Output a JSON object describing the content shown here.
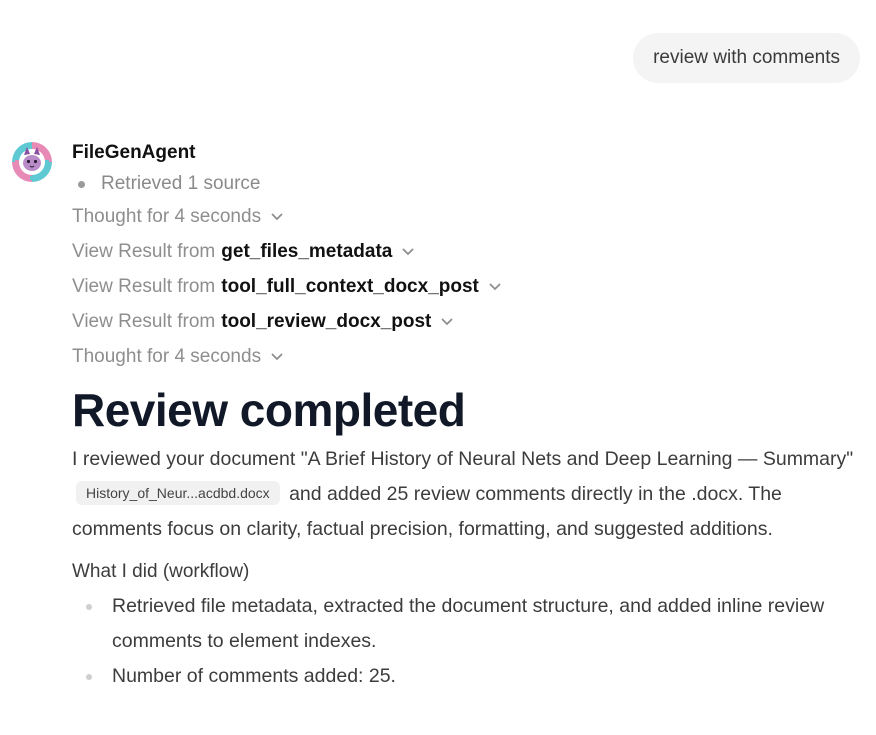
{
  "user_message": "review with comments",
  "agent": {
    "name": "FileGenAgent",
    "sources": "Retrieved 1 source"
  },
  "steps": [
    {
      "prefix": "Thought for 4 seconds",
      "tool": ""
    },
    {
      "prefix": "View Result from",
      "tool": "get_files_metadata"
    },
    {
      "prefix": "View Result from",
      "tool": "tool_full_context_docx_post"
    },
    {
      "prefix": "View Result from",
      "tool": "tool_review_docx_post"
    },
    {
      "prefix": "Thought for 4 seconds",
      "tool": ""
    }
  ],
  "response": {
    "heading": "Review completed",
    "para_before_chip": "I reviewed your document \"A Brief History of Neural Nets and Deep Learning — Summary\"",
    "file_chip": "History_of_Neur...acdbd.docx",
    "para_after_chip": "and added 25 review comments directly in the .docx. The comments focus on clarity, factual precision, formatting, and suggested additions.",
    "subheading": "What I did (workflow)",
    "bullets": [
      "Retrieved file metadata, extracted the document structure, and added inline review comments to element indexes.",
      "Number of comments added: 25."
    ]
  },
  "colors": {
    "bubble_bg": "#f4f4f4",
    "muted_text": "#8e8e8e",
    "heading_text": "#111827",
    "chip_bg": "#f1f1f1"
  }
}
